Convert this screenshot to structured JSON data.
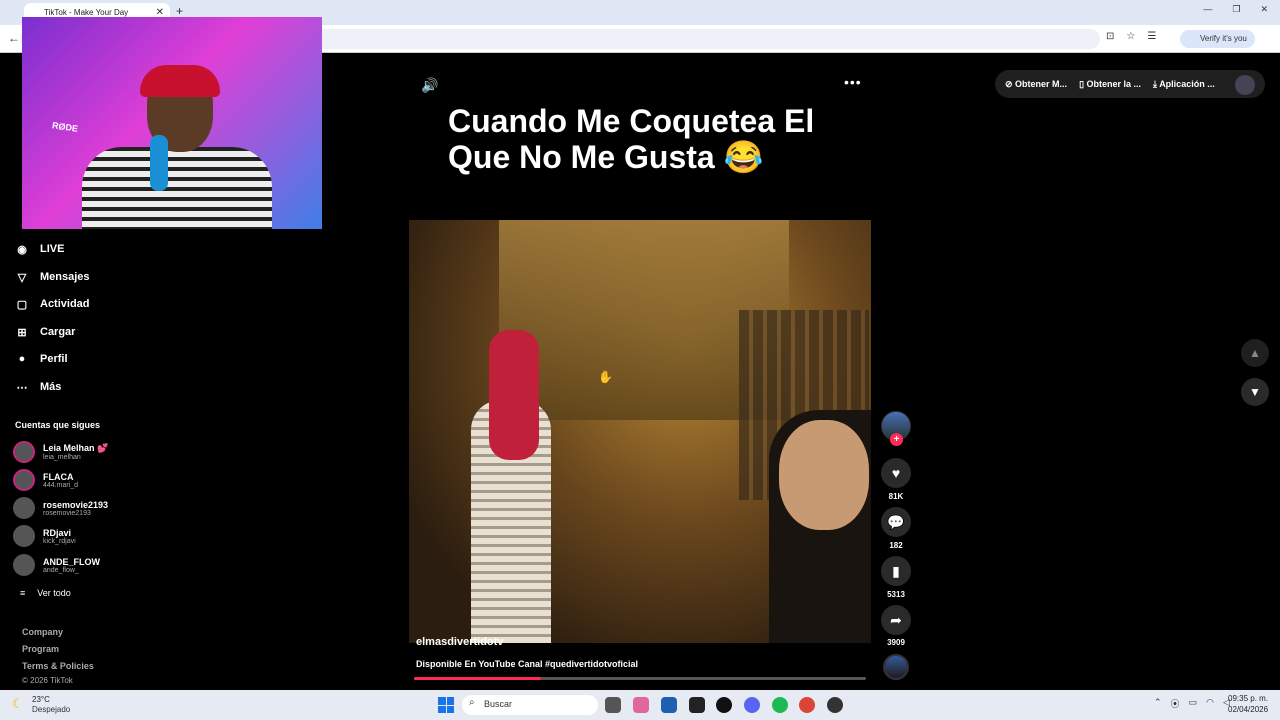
{
  "browser": {
    "tab_title": "TikTok - Make Your Day",
    "tab_close": "✕",
    "new_tab": "+",
    "verify_label": "Verify it's you",
    "window_controls": [
      "—",
      "❐",
      "✕"
    ]
  },
  "sidebar": {
    "nav": [
      {
        "label": "LIVE",
        "icon": "live-icon",
        "glyph": "◉"
      },
      {
        "label": "Mensajes",
        "icon": "messages-icon",
        "glyph": "▽"
      },
      {
        "label": "Actividad",
        "icon": "activity-icon",
        "glyph": "▢"
      },
      {
        "label": "Cargar",
        "icon": "upload-icon",
        "glyph": "⊞"
      },
      {
        "label": "Perfil",
        "icon": "profile-icon",
        "glyph": "●"
      },
      {
        "label": "Más",
        "icon": "more-icon",
        "glyph": "⋯"
      }
    ],
    "following_title": "Cuentas que sigues",
    "accounts": [
      {
        "name": "Leia Melhan 💕",
        "handle": "leia_melhan"
      },
      {
        "name": "FLACA",
        "handle": "444.mari_d"
      },
      {
        "name": "rosemovie2193",
        "handle": "rosemovie2193"
      },
      {
        "name": "RDjavi",
        "handle": "kick_rdjavi"
      },
      {
        "name": "ANDE_FLOW",
        "handle": "ande_flow_"
      }
    ],
    "see_all": "Ver todo",
    "footer": [
      "Company",
      "Program",
      "Terms & Policies",
      "© 2026 TikTok"
    ]
  },
  "webcam": {
    "mic_brand": "RØDE"
  },
  "video": {
    "headline": "Cuando Me Coquetea El Que No Me Gusta 😂",
    "username": "elmasdivertidotv",
    "caption": "Disponible En YouTube Canal #quedivertidotvoficial",
    "progress": 0.28
  },
  "actions": {
    "likes": "81K",
    "comments": "182",
    "saves": "5313",
    "shares": "3909",
    "follow_plus": "+"
  },
  "topbar": {
    "items": [
      "Obtener M...",
      "Obtener la ...",
      "Aplicación ..."
    ]
  },
  "taskbar": {
    "temperature": "23°C",
    "weather": "Despejado",
    "search_placeholder": "Buscar",
    "time": "09:35 p. m.",
    "date": "02/04/2026"
  },
  "colors": {
    "accent": "#fe2c55",
    "taskbar": "#e6ebf3",
    "tab_strip": "#dfe7f5"
  }
}
